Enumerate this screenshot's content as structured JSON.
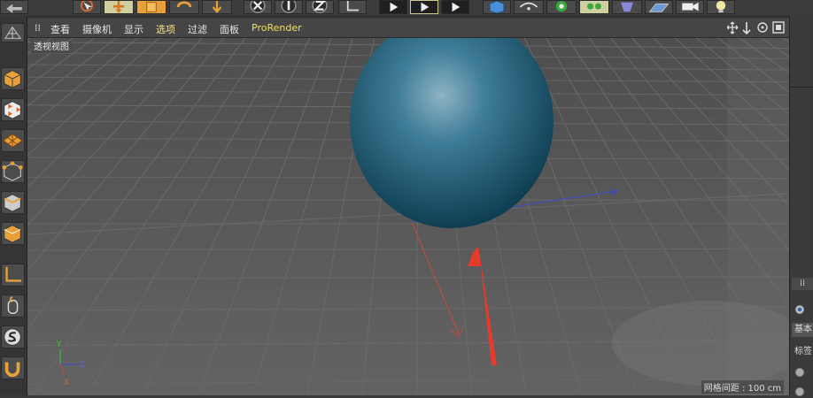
{
  "toolbar": {
    "icons": [
      "undo-icon",
      "live-select-icon",
      "move-icon",
      "scale-icon",
      "rotate-icon",
      "recent-tool-icon",
      "x-axis-lock-icon",
      "y-axis-lock-icon",
      "z-axis-lock-icon",
      "coordinate-system-icon",
      "render-view-icon",
      "render-active-icon",
      "render-settings-icon",
      "cube-icon",
      "pen-icon",
      "subdivision-icon",
      "array-icon",
      "deformer-icon",
      "floor-icon",
      "camera-icon",
      "light-icon"
    ]
  },
  "left_tools": [
    "model-mode-icon",
    "object-mode-icon",
    "texture-mode-icon",
    "polygon-mode-icon",
    "point-mode-icon",
    "edge-mode-icon",
    "poly-mode-icon",
    "axis-mode-icon",
    "tweak-mode-icon",
    "snap-icon",
    "magnet-icon"
  ],
  "viewport": {
    "menu": {
      "view": "查看",
      "cameras": "摄像机",
      "display": "显示",
      "options": "选项",
      "filter": "过滤",
      "panel": "面板",
      "prorender": "ProRender"
    },
    "label": "透视视图",
    "grid_spacing": "网格间距 : 100 cm",
    "axis": {
      "x": "X",
      "y": "Y",
      "z": "Z"
    },
    "colors": {
      "sphere": "#1f5f7a",
      "x_axis": "#c84a3a",
      "z_axis": "#3a4ad0",
      "annotation_arrow": "#e83a2a"
    }
  },
  "right_panel": {
    "tab1": "基本",
    "tab2": "标签"
  }
}
